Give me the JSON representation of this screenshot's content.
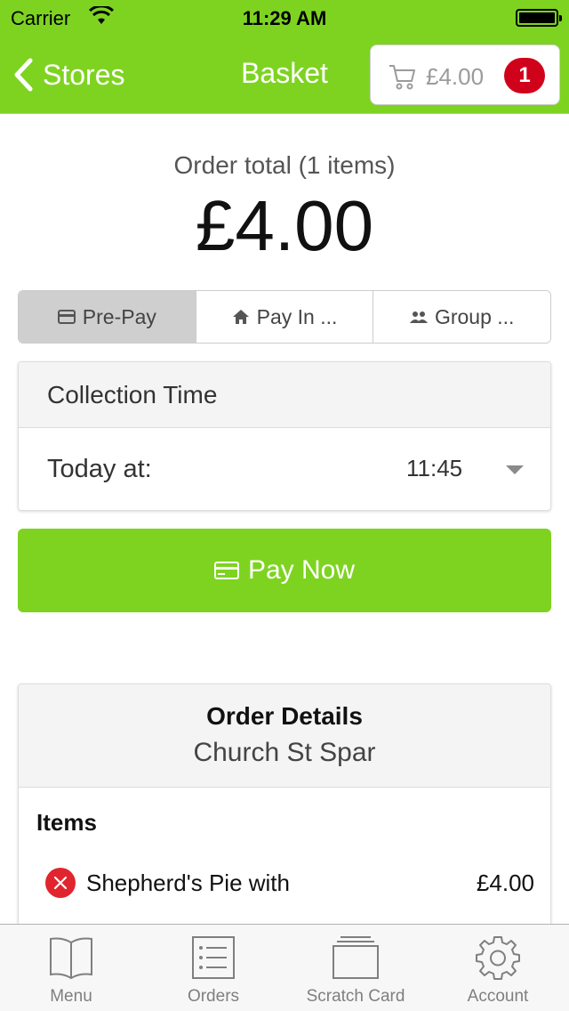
{
  "status_bar": {
    "carrier": "Carrier",
    "time": "11:29 AM"
  },
  "nav": {
    "back_label": "Stores",
    "title": "Basket",
    "cart_amount": "£4.00",
    "cart_badge": "1"
  },
  "order_total": {
    "label": "Order total (1 items)",
    "value": "£4.00"
  },
  "payment_options": [
    {
      "label": "Pre-Pay",
      "icon": "credit-card-icon",
      "selected": true
    },
    {
      "label": "Pay In ...",
      "icon": "home-icon",
      "selected": false
    },
    {
      "label": "Group ...",
      "icon": "group-icon",
      "selected": false
    }
  ],
  "collection": {
    "title": "Collection Time",
    "day_label": "Today at:",
    "time_value": "11:45"
  },
  "pay_button": {
    "label": "Pay Now",
    "icon": "credit-card-icon"
  },
  "order_details": {
    "title": "Order Details",
    "store": "Church St Spar",
    "items_heading": "Items",
    "items": [
      {
        "name": "Shepherd's Pie with",
        "price": "£4.00"
      }
    ]
  },
  "tabs": [
    {
      "label": "Menu",
      "icon": "book-icon"
    },
    {
      "label": "Orders",
      "icon": "list-icon"
    },
    {
      "label": "Scratch Card",
      "icon": "scratch-card-icon"
    },
    {
      "label": "Account",
      "icon": "gear-icon"
    }
  ],
  "colors": {
    "brand_green": "#7ed321",
    "badge_red": "#d0021b",
    "remove_red": "#e0252e"
  }
}
